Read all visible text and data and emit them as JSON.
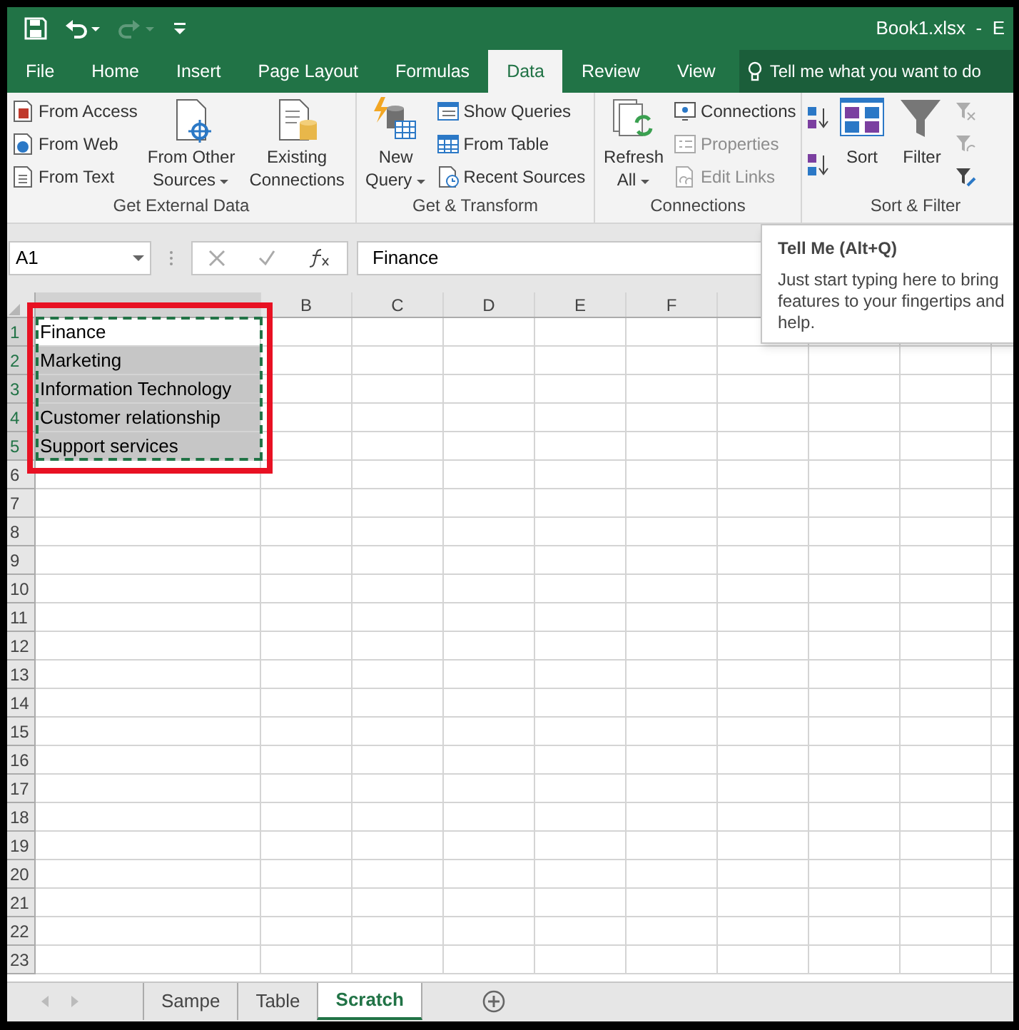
{
  "window": {
    "title": "Book1.xlsx  -  E"
  },
  "tabs": [
    {
      "label": "File",
      "selected": false
    },
    {
      "label": "Home",
      "selected": false
    },
    {
      "label": "Insert",
      "selected": false
    },
    {
      "label": "Page Layout",
      "selected": false
    },
    {
      "label": "Formulas",
      "selected": false
    },
    {
      "label": "Data",
      "selected": true
    },
    {
      "label": "Review",
      "selected": false
    },
    {
      "label": "View",
      "selected": false
    }
  ],
  "tell_me": {
    "placeholder": "Tell me what you want to do"
  },
  "ribbon": {
    "groups": [
      {
        "label": "Get External Data",
        "items": [
          {
            "kind": "small",
            "label": "From Access",
            "disabled": false
          },
          {
            "kind": "small",
            "label": "From Web",
            "disabled": false
          },
          {
            "kind": "small",
            "label": "From Text",
            "disabled": false
          },
          {
            "kind": "large",
            "lines": [
              "From Other",
              "Sources"
            ],
            "dropdown": true,
            "disabled": false
          },
          {
            "kind": "large",
            "lines": [
              "Existing",
              "Connections"
            ],
            "dropdown": false,
            "disabled": false
          }
        ]
      },
      {
        "label": "Get & Transform",
        "items": [
          {
            "kind": "large",
            "lines": [
              "New",
              "Query"
            ],
            "dropdown": true,
            "disabled": false
          },
          {
            "kind": "small",
            "label": "Show Queries",
            "disabled": false
          },
          {
            "kind": "small",
            "label": "From Table",
            "disabled": false
          },
          {
            "kind": "small",
            "label": "Recent Sources",
            "disabled": false
          }
        ]
      },
      {
        "label": "Connections",
        "items": [
          {
            "kind": "large",
            "lines": [
              "Refresh",
              "All"
            ],
            "dropdown": true,
            "disabled": false
          },
          {
            "kind": "small",
            "label": "Connections",
            "disabled": false
          },
          {
            "kind": "small",
            "label": "Properties",
            "disabled": true
          },
          {
            "kind": "small",
            "label": "Edit Links",
            "disabled": true
          }
        ]
      },
      {
        "label": "Sort & Filter",
        "items": [
          {
            "kind": "icon",
            "disabled": false
          },
          {
            "kind": "icon",
            "disabled": false
          },
          {
            "kind": "large",
            "lines": [
              "Sort"
            ],
            "dropdown": false,
            "disabled": false
          },
          {
            "kind": "large",
            "lines": [
              "Filter"
            ],
            "dropdown": false,
            "disabled": false
          },
          {
            "kind": "icon",
            "disabled": true
          },
          {
            "kind": "icon",
            "disabled": true
          },
          {
            "kind": "icon",
            "disabled": false
          }
        ]
      }
    ]
  },
  "formula_bar": {
    "name_box": "A1",
    "value": "Finance"
  },
  "tooltip": {
    "title": "Tell Me (Alt+Q)",
    "lines": [
      "Just start typing here to bring",
      "features to your fingertips and",
      "help."
    ]
  },
  "sheet": {
    "columns": [
      "B",
      "C",
      "D",
      "E",
      "F"
    ],
    "rows": [
      {
        "number": "1",
        "text": "Finance",
        "selected": true,
        "active": true
      },
      {
        "number": "2",
        "text": "Marketing",
        "selected": true,
        "active": false
      },
      {
        "number": "3",
        "text": "Information Technology",
        "selected": true,
        "active": false
      },
      {
        "number": "4",
        "text": "Customer relationship",
        "selected": true,
        "active": false
      },
      {
        "number": "5",
        "text": "Support services",
        "selected": true,
        "active": false
      },
      {
        "number": "6",
        "selected": false,
        "active": false
      },
      {
        "number": "7",
        "selected": false,
        "active": false
      },
      {
        "number": "8",
        "selected": false,
        "active": false
      },
      {
        "number": "9",
        "selected": false,
        "active": false
      },
      {
        "number": "10",
        "selected": false,
        "active": false
      },
      {
        "number": "11",
        "selected": false,
        "active": false
      },
      {
        "number": "12",
        "selected": false,
        "active": false
      },
      {
        "number": "13",
        "selected": false,
        "active": false
      },
      {
        "number": "14",
        "selected": false,
        "active": false
      },
      {
        "number": "15",
        "selected": false,
        "active": false
      },
      {
        "number": "16",
        "selected": false,
        "active": false
      },
      {
        "number": "17",
        "selected": false,
        "active": false
      },
      {
        "number": "18",
        "selected": false,
        "active": false
      },
      {
        "number": "19",
        "selected": false,
        "active": false
      },
      {
        "number": "20",
        "selected": false,
        "active": false
      },
      {
        "number": "21",
        "selected": false,
        "active": false
      },
      {
        "number": "22",
        "selected": false,
        "active": false
      },
      {
        "number": "23",
        "selected": false,
        "active": false
      }
    ]
  },
  "sheet_tabs": [
    {
      "label": "Sampe",
      "selected": false
    },
    {
      "label": "Table",
      "selected": false
    },
    {
      "label": "Scratch",
      "selected": true
    }
  ]
}
